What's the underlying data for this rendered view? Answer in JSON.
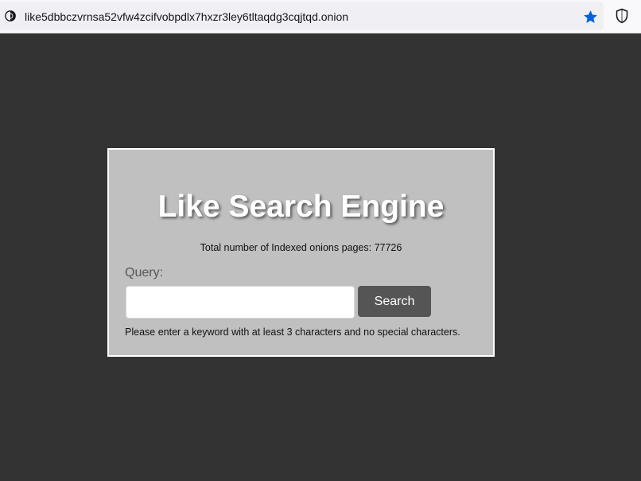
{
  "browser": {
    "url": "like5dbbczvrnsa52vfw4zcifvobpdlx7hxzr3ley6tltaqdg3cqjtqd.onion",
    "icons": {
      "site": "onion-site-icon",
      "bookmark": "star-filled-icon",
      "shield": "shield-icon"
    },
    "accent_color": "#0060df"
  },
  "search": {
    "title": "Like Search Engine",
    "index_count_text": "Total number of Indexed onions pages: 77726",
    "query_label": "Query:",
    "query_value": "",
    "button_label": "Search",
    "hint": "Please enter a keyword with at least 3 characters and no special characters."
  },
  "colors": {
    "page_background": "#333333",
    "card_background": "#c0c0c0",
    "button_background": "#555555"
  }
}
